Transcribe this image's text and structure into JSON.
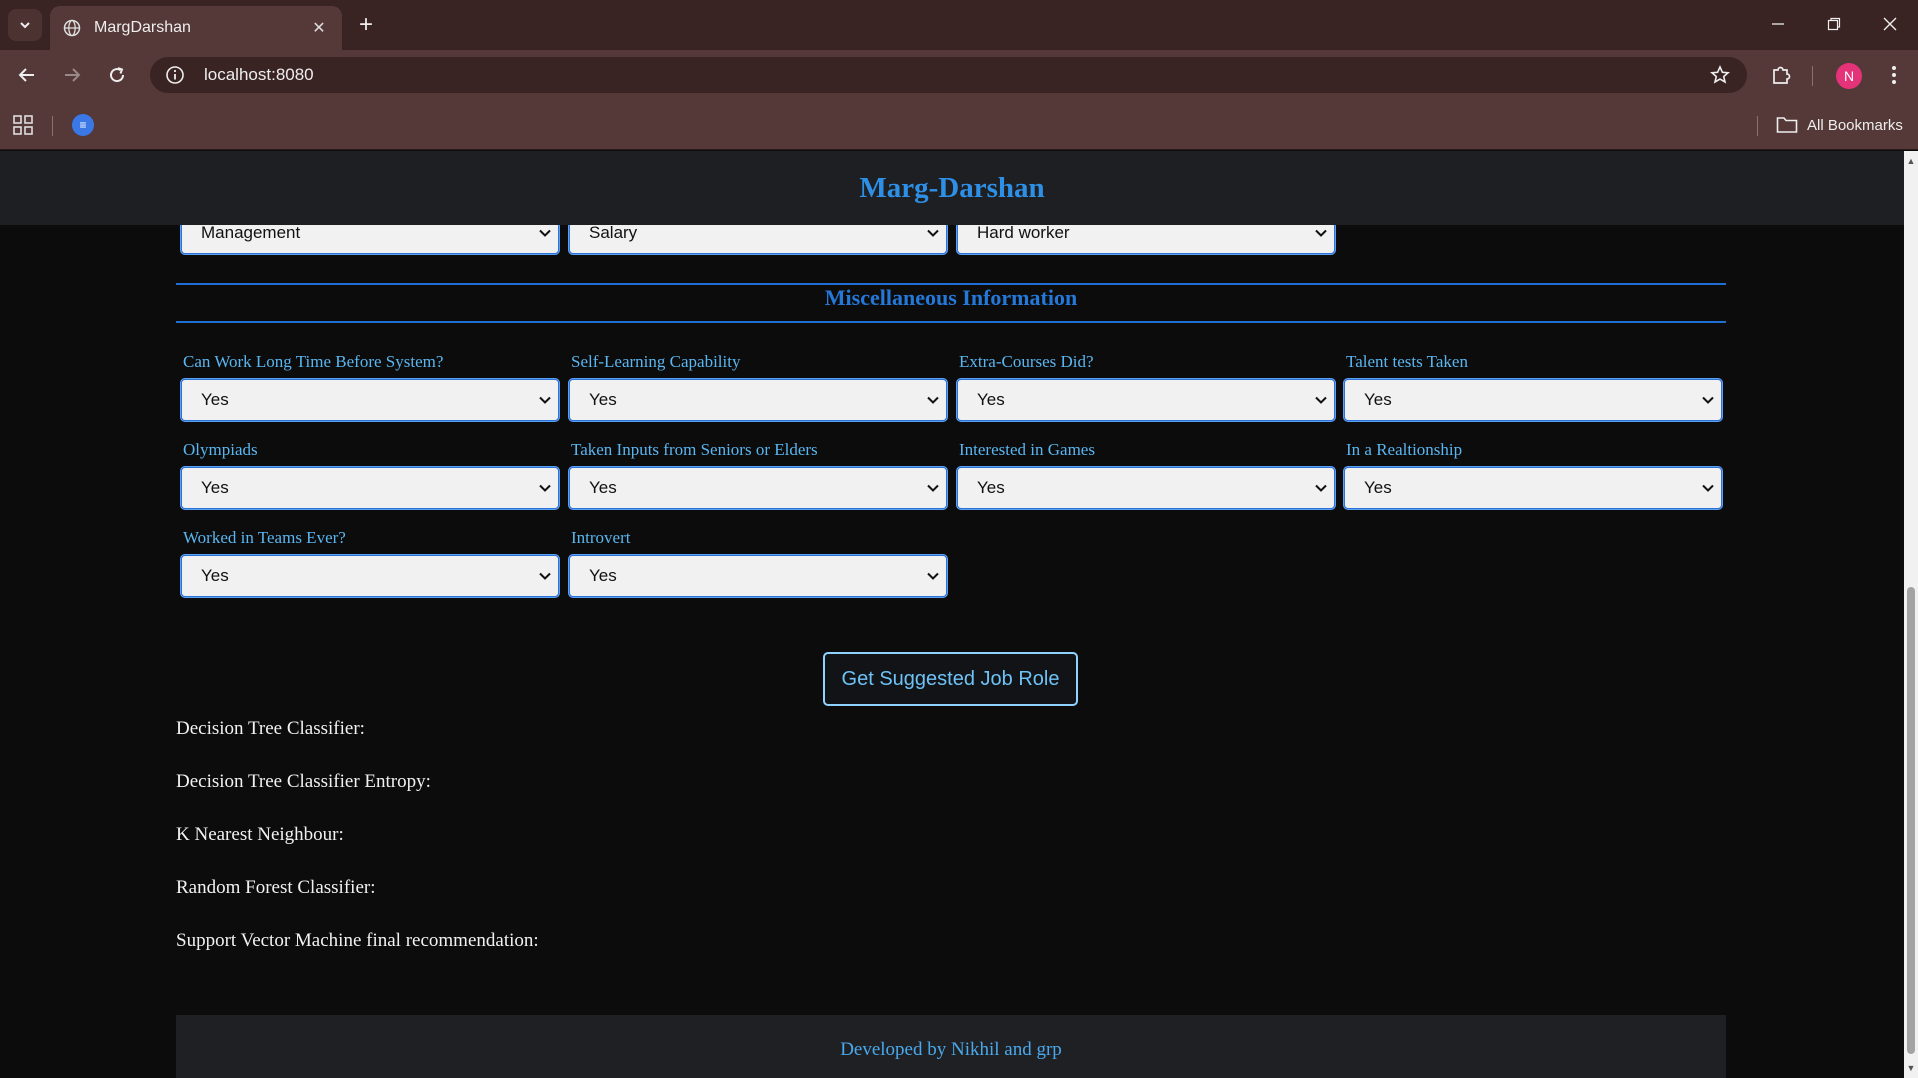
{
  "browser": {
    "tab_title": "MargDarshan",
    "url": "localhost:8080",
    "profile_initial": "N",
    "all_bookmarks_label": "All Bookmarks",
    "bookmark_favicon_glyph": "≡",
    "new_tab_glyph": "+",
    "tab_close_glyph": "✕"
  },
  "header": {
    "title": "Marg-Darshan"
  },
  "top_selects": [
    {
      "value": "Management"
    },
    {
      "value": "Salary"
    },
    {
      "value": "Hard worker"
    }
  ],
  "misc": {
    "section_title": "Miscellaneous Information",
    "fields": [
      {
        "label": "Can Work Long Time Before System?",
        "value": "Yes"
      },
      {
        "label": "Self-Learning Capability",
        "value": "Yes"
      },
      {
        "label": "Extra-Courses Did?",
        "value": "Yes"
      },
      {
        "label": "Talent tests Taken",
        "value": "Yes"
      },
      {
        "label": "Olympiads",
        "value": "Yes"
      },
      {
        "label": "Taken Inputs from Seniors or Elders",
        "value": "Yes"
      },
      {
        "label": "Interested in Games",
        "value": "Yes"
      },
      {
        "label": "In a Realtionship",
        "value": "Yes"
      },
      {
        "label": "Worked in Teams Ever?",
        "value": "Yes"
      },
      {
        "label": "Introvert",
        "value": "Yes"
      }
    ]
  },
  "submit_label": "Get Suggested Job Role",
  "results": [
    "Decision Tree Classifier:",
    "Decision Tree Classifier Entropy:",
    "K Nearest Neighbour:",
    "Random Forest Classifier:",
    "Support Vector Machine final recommendation:"
  ],
  "footer": {
    "text": "Developed by Nikhil and grp"
  },
  "colors": {
    "accent": "#2e8fe6",
    "label": "#5ab6f0",
    "divider": "#1d6fd3",
    "chrome": "#553838"
  }
}
